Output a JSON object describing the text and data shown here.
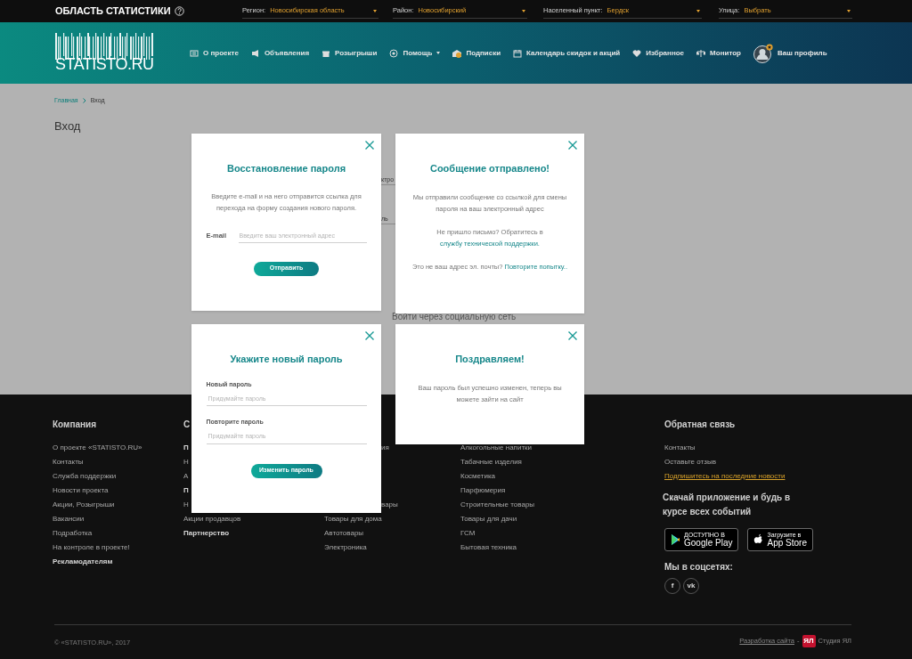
{
  "top_bar": {
    "title": "ОБЛАСТЬ СТАТИСТИКИ",
    "selectors": [
      {
        "label": "Регион:",
        "value": "Новосибирская область"
      },
      {
        "label": "Район:",
        "value": "Новосибирский"
      },
      {
        "label": "Населенный пункт:",
        "value": "Бердск"
      },
      {
        "label": "Улица:",
        "value": "Выбрать"
      }
    ]
  },
  "header": {
    "logo": "STATISTO.RU",
    "nav": [
      {
        "label": "О проекте",
        "dropdown": false
      },
      {
        "label": "Объявления",
        "dropdown": false
      },
      {
        "label": "Розыгрыши",
        "dropdown": false
      },
      {
        "label": "Помощь",
        "dropdown": true
      },
      {
        "label": "Подписки",
        "dropdown": false
      },
      {
        "label": "Календарь скидок и акций",
        "dropdown": false
      },
      {
        "label": "Избранное",
        "dropdown": false
      },
      {
        "label": "Монитор",
        "dropdown": false
      }
    ],
    "profile": "Ваш профиль"
  },
  "breadcrumbs": [
    {
      "label": "Главная",
      "link": true
    },
    {
      "label": "Вход",
      "link": false
    }
  ],
  "page_title": "Вход",
  "login_form": {
    "field_fragments": [
      "ктро",
      "ль"
    ],
    "social_title": "Войти через социальную сеть"
  },
  "modals": [
    {
      "kind": "inline_form",
      "title": "Восстановление пароля",
      "text": "Введите e-mail и на него отправится ссылка для перехода на форму создания нового пароля.",
      "fields": [
        {
          "label": "E-mail",
          "placeholder": "Введите ваш электронный адрес"
        }
      ],
      "button": "Отправить"
    },
    {
      "kind": "message",
      "title": "Сообщение отправлено!",
      "paragraphs": [
        {
          "text": "Мы отправили сообщение со ссылкой для смены пароля на ваш электронный адрес"
        },
        {
          "text": "Не пришло письмо? Обратитесь в",
          "link": "службу технической поддержки."
        },
        {
          "text": "Это не ваш адрес эл. почты?",
          "link": "Повторите попытку.."
        }
      ]
    },
    {
      "kind": "stacked_form",
      "title": "Укажите новый пароль",
      "fields": [
        {
          "label": "Новый пароль",
          "placeholder": "Придумайте пароль"
        },
        {
          "label": "Повторите пароль",
          "placeholder": "Придумайте пароль"
        }
      ],
      "button": "Изменить пароль"
    },
    {
      "kind": "message",
      "title": "Поздравляем!",
      "paragraphs": [
        {
          "text": "Ваш пароль был успешно изменен, теперь вы можете зайти на сайт"
        }
      ]
    }
  ],
  "footer": {
    "columns": [
      {
        "title": "Компания",
        "items": [
          {
            "label": "О проекте «STATISTO.RU»",
            "bold": false
          },
          {
            "label": "Контакты",
            "bold": false
          },
          {
            "label": "Служба поддержки",
            "bold": false
          },
          {
            "label": "Новости проекта",
            "bold": false
          },
          {
            "label": "Акции, Розыгрыши",
            "bold": false
          },
          {
            "label": "Вакансии",
            "bold": false
          },
          {
            "label": "Подработка",
            "bold": false
          },
          {
            "label": "На контроле в проекте!",
            "bold": false
          },
          {
            "label": "Рекламодателям",
            "bold": true
          }
        ]
      },
      {
        "title": "С",
        "items": [
          {
            "label": "П",
            "bold": true
          },
          {
            "label": "Н",
            "bold": false
          },
          {
            "label": "А",
            "bold": false
          },
          {
            "label": "П",
            "bold": true
          },
          {
            "label": "Н",
            "bold": false
          },
          {
            "label": "Акции продавцов",
            "bold": false
          },
          {
            "label": "Партнерство",
            "bold": true
          }
        ]
      },
      {
        "items": [
          {
            "label": "ия",
            "bold": false
          },
          {
            "label": "вары",
            "bold": false
          },
          {
            "label": "Товары для дома",
            "bold": false
          },
          {
            "label": "Автотовары",
            "bold": false
          },
          {
            "label": "Электроника",
            "bold": false
          }
        ]
      },
      {
        "items": [
          {
            "label": "Алкогольные напитки",
            "bold": false
          },
          {
            "label": "Табачные изделия",
            "bold": false
          },
          {
            "label": "Косметика",
            "bold": false
          },
          {
            "label": "Парфюмерия",
            "bold": false
          },
          {
            "label": "Строительные товары",
            "bold": false
          },
          {
            "label": "Товары для дачи",
            "bold": false
          },
          {
            "label": "ГСМ",
            "bold": false
          },
          {
            "label": "Бытовая техника",
            "bold": false
          }
        ]
      }
    ],
    "feedback": {
      "title": "Обратная связь",
      "items": [
        "Контакты",
        "Оставьте отзыв"
      ],
      "subscribe_link": "Подпишитесь на последние новости"
    },
    "app": {
      "title": "Скачай приложение и будь в курсе всех событий",
      "stores": [
        {
          "small": "ДОСТУПНО В",
          "name": "Google Play"
        },
        {
          "small": "Загрузите в",
          "name": "App Store"
        }
      ]
    },
    "social": {
      "title": "Мы в соцсетях:",
      "buttons": [
        "f",
        "vk"
      ]
    },
    "copyright": "© «STATISTO.RU», 2017",
    "developer": {
      "link": "Разработка сайта",
      "separator": "-",
      "logo": "ЯЛ",
      "name": "Студия ЯЛ"
    }
  }
}
